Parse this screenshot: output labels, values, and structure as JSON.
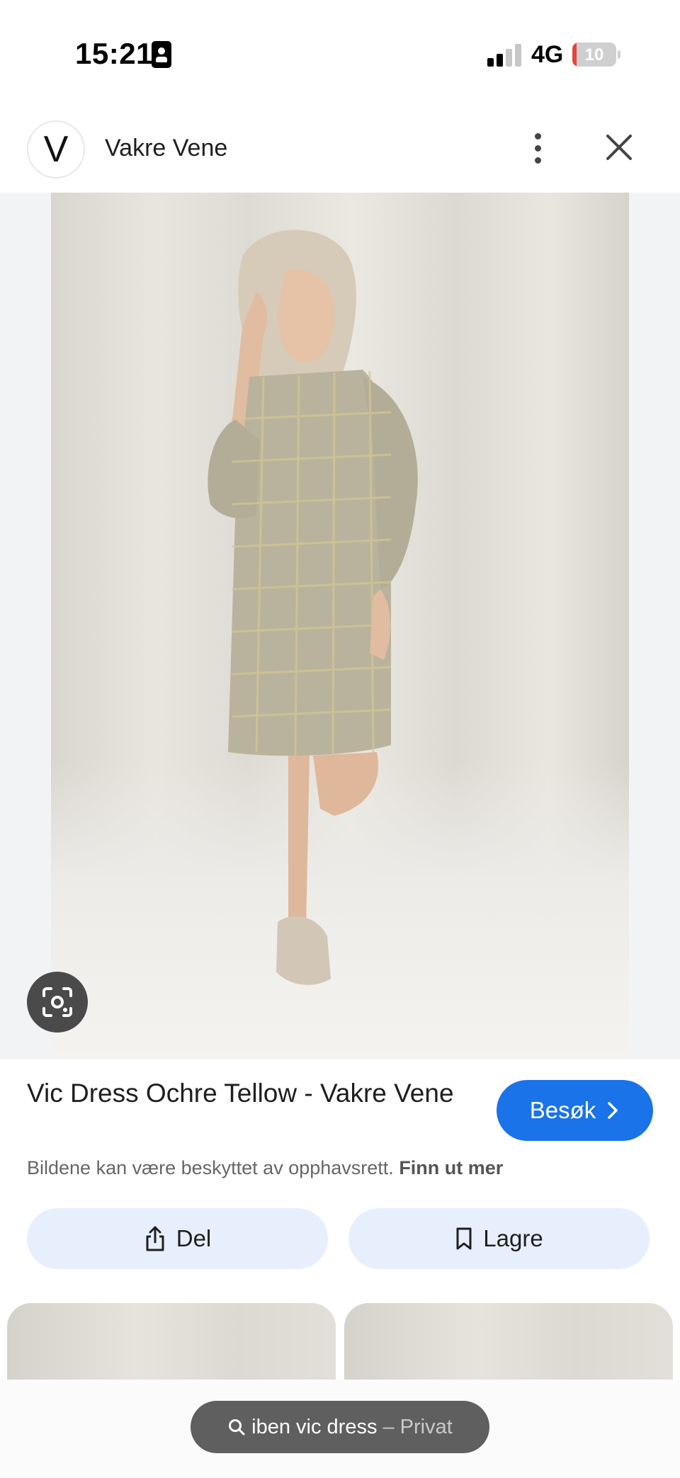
{
  "status_bar": {
    "time": "15:21",
    "network": "4G",
    "battery_level": "10",
    "battery_fraction": 0.1,
    "battery_color": "#e5453b",
    "signal_bars_active": 2
  },
  "header": {
    "site_initial": "V",
    "site_name": "Vakre Vene",
    "more_icon": "more-vert-icon",
    "close_icon": "close-icon"
  },
  "image": {
    "lens_icon": "google-lens-icon"
  },
  "result": {
    "title": "Vic Dress Ochre Tellow - Vakre Vene",
    "visit_label": "Besøk",
    "copyright_text": "Bildene kan være beskyttet av opphavsrett.",
    "learn_more": "Finn ut mer"
  },
  "actions": {
    "share_label": "Del",
    "save_label": "Lagre"
  },
  "search_pill": {
    "query": "iben vic dress",
    "mode": "– Privat"
  },
  "colors": {
    "accent": "#1a73e8",
    "action_bg": "#e8effc",
    "pill_bg": "#5f5f5f"
  }
}
